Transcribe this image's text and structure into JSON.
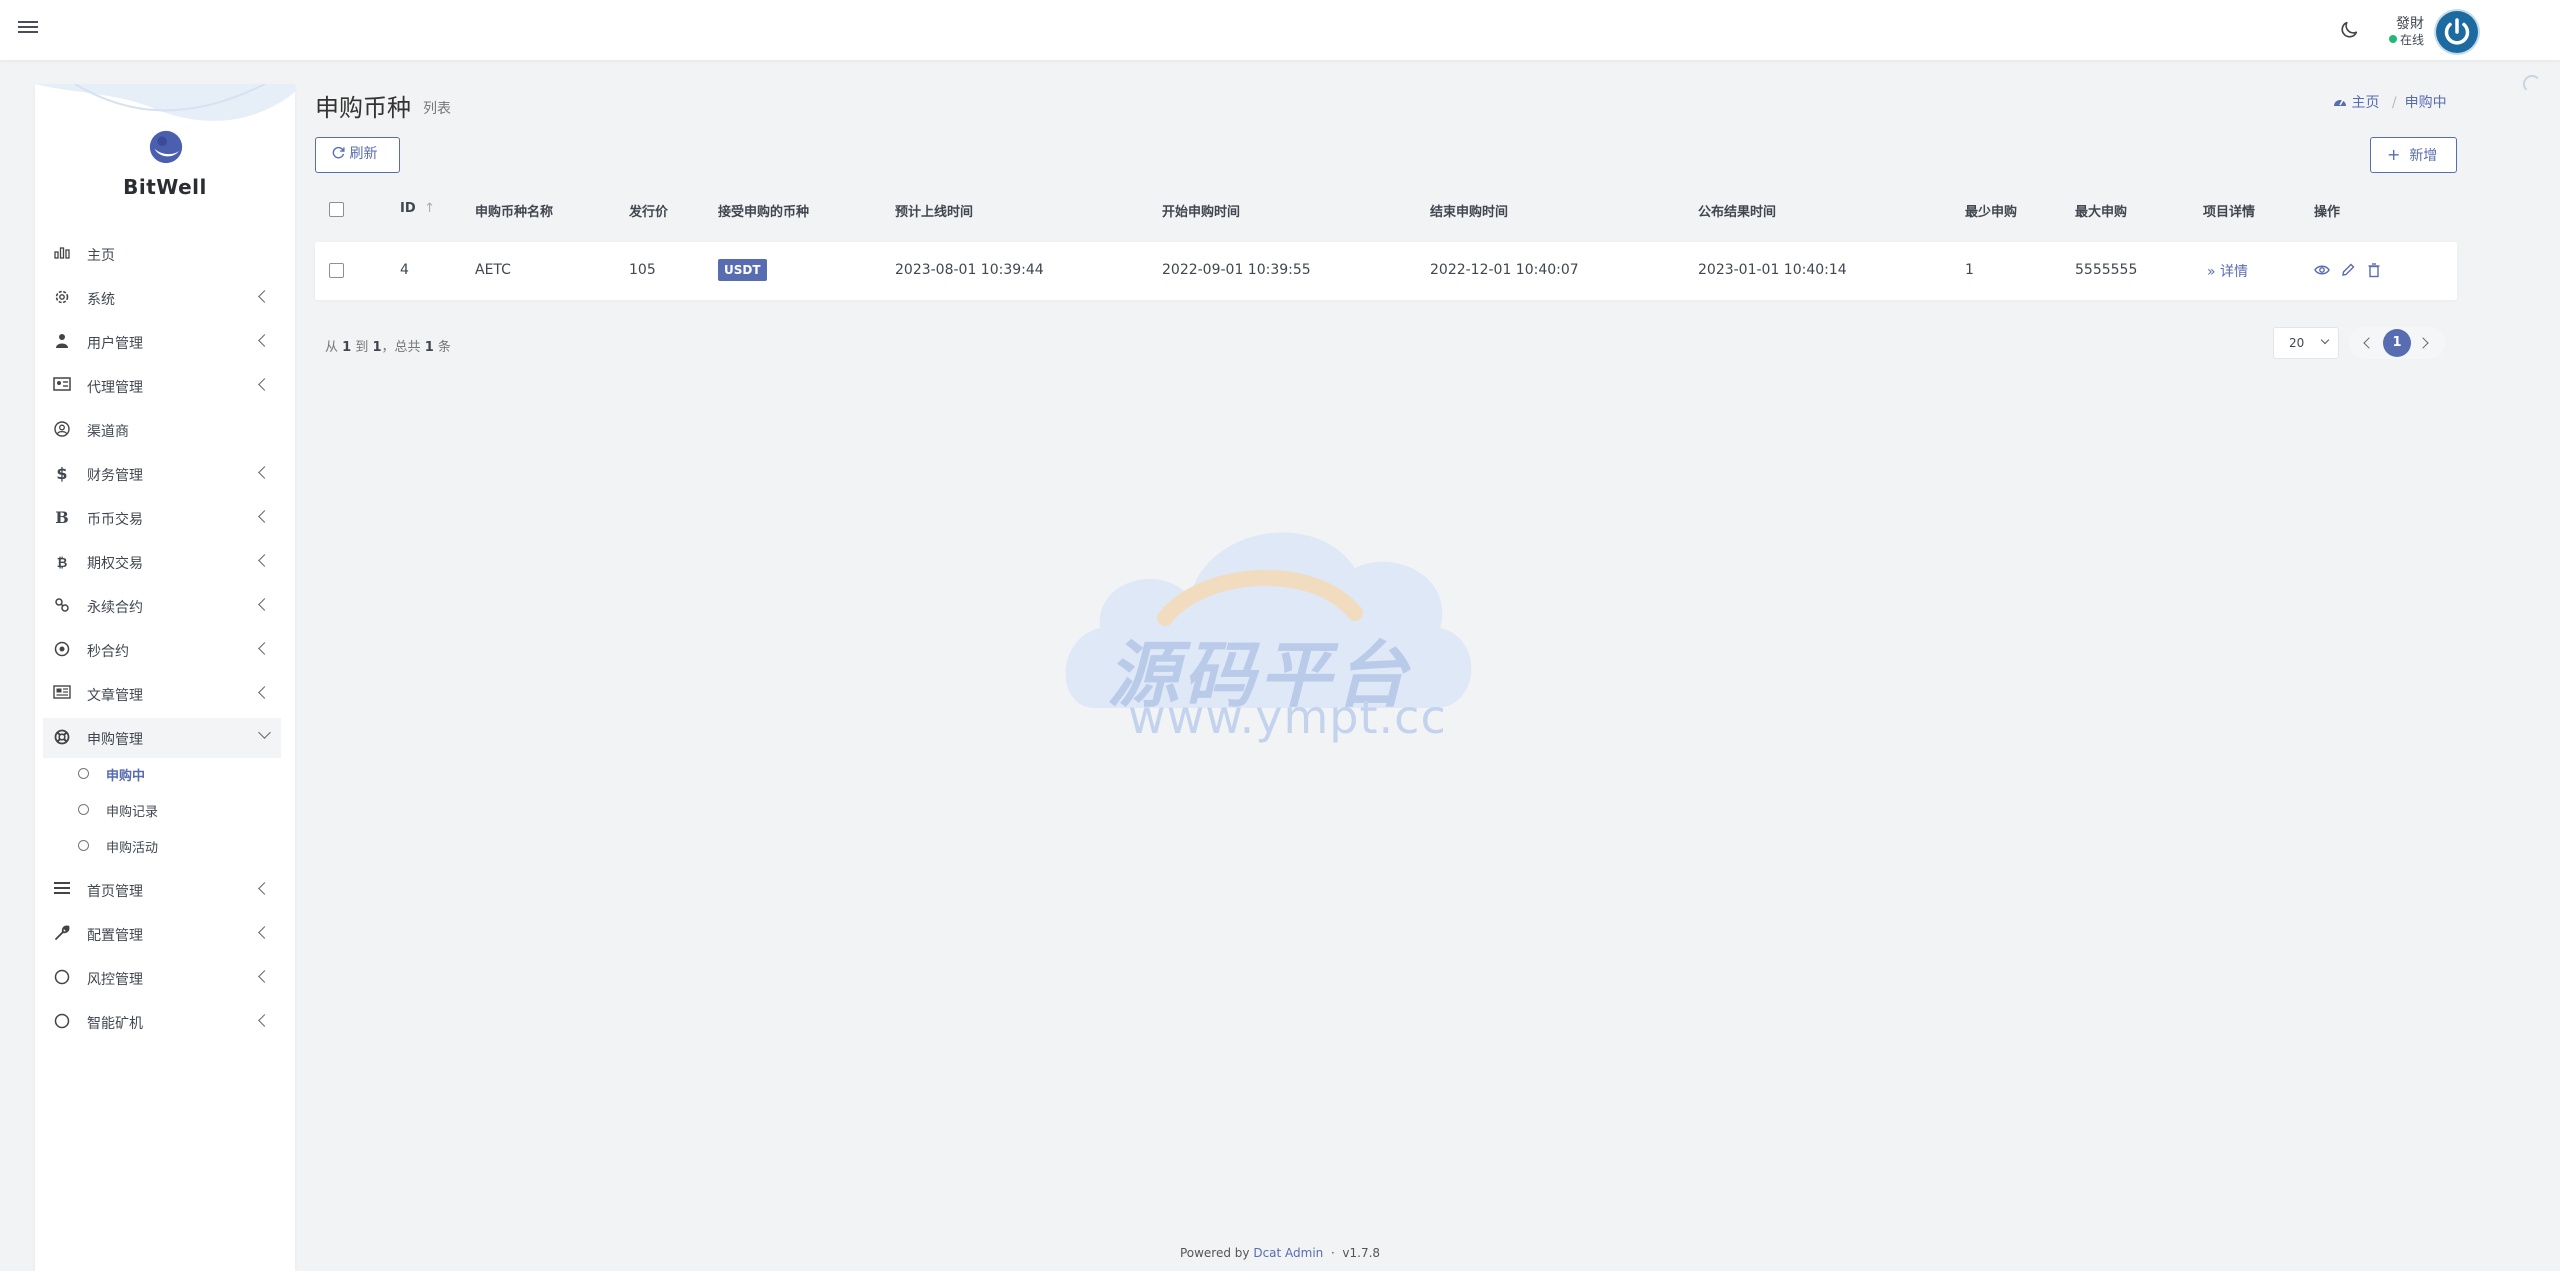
{
  "header": {
    "user_name": "發財",
    "user_status": "在线"
  },
  "sidebar": {
    "brand": "BitWell",
    "items": [
      {
        "label": "主页",
        "icon": "bar-chart-icon",
        "has_children": false
      },
      {
        "label": "系统",
        "icon": "gear-icon",
        "has_children": true
      },
      {
        "label": "用户管理",
        "icon": "user-tie-icon",
        "has_children": true
      },
      {
        "label": "代理管理",
        "icon": "id-card-icon",
        "has_children": true
      },
      {
        "label": "渠道商",
        "icon": "user-circle-icon",
        "has_children": false
      },
      {
        "label": "财务管理",
        "icon": "dollar-icon",
        "has_children": true
      },
      {
        "label": "币币交易",
        "icon": "bitcoin-b-icon",
        "has_children": true
      },
      {
        "label": "期权交易",
        "icon": "bitcoin-icon",
        "has_children": true
      },
      {
        "label": "永续合约",
        "icon": "link-icon",
        "has_children": true
      },
      {
        "label": "秒合约",
        "icon": "dot-circle-icon",
        "has_children": true
      },
      {
        "label": "文章管理",
        "icon": "newspaper-icon",
        "has_children": true
      },
      {
        "label": "申购管理",
        "icon": "life-ring-icon",
        "has_children": true,
        "expanded": true
      },
      {
        "label": "首页管理",
        "icon": "bars-icon",
        "has_children": true
      },
      {
        "label": "配置管理",
        "icon": "wrench-icon",
        "has_children": true
      },
      {
        "label": "风控管理",
        "icon": "circle-icon",
        "has_children": true
      },
      {
        "label": "智能矿机",
        "icon": "circle-icon",
        "has_children": true
      }
    ],
    "sub_items": [
      {
        "label": "申购中",
        "current": true
      },
      {
        "label": "申购记录",
        "current": false
      },
      {
        "label": "申购活动",
        "current": false
      }
    ]
  },
  "page": {
    "title": "申购币种",
    "subtitle": "列表",
    "breadcrumb": {
      "home": "主页",
      "current": "申购中"
    },
    "refresh_label": "刷新",
    "new_label": "新增"
  },
  "table": {
    "columns": [
      "ID",
      "申购币种名称",
      "发行价",
      "接受申购的币种",
      "预计上线时间",
      "开始申购时间",
      "结束申购时间",
      "公布结果时间",
      "最少申购",
      "最大申购",
      "项目详情",
      "操作"
    ],
    "rows": [
      {
        "id": "4",
        "name": "AETC",
        "price": "105",
        "accept_coin": "USDT",
        "online_time": "2023-08-01 10:39:44",
        "start_time": "2022-09-01 10:39:55",
        "end_time": "2022-12-01 10:40:07",
        "result_time": "2023-01-01 10:40:14",
        "min": "1",
        "max": "5555555",
        "detail_label": "详情"
      }
    ]
  },
  "pager": {
    "prefix": "从",
    "from": "1",
    "to_word": "到",
    "to": "1",
    "total_word": "，总共",
    "total": "1",
    "suffix": "条",
    "per_page": "20",
    "current_page": "1"
  },
  "watermark": {
    "text": "源码平台",
    "url": "www.ympt.cc"
  },
  "footer": {
    "powered": "Powered by",
    "link": "Dcat Admin",
    "sep": "·",
    "version": "v1.7.8"
  },
  "colors": {
    "primary": "#586cb1",
    "online": "#21b978",
    "background": "#f2f3f5"
  }
}
